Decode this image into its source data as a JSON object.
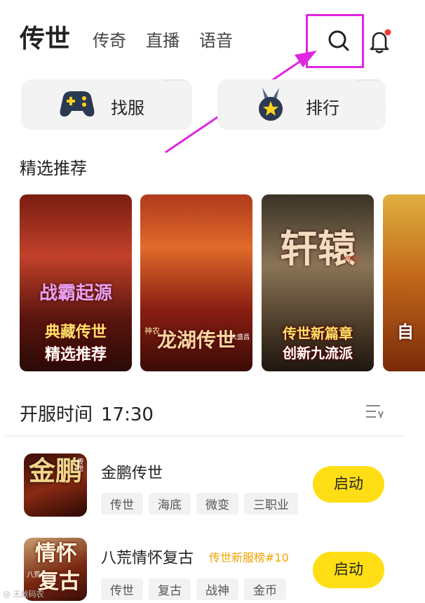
{
  "tabs": {
    "active": "传世",
    "items": [
      "传奇",
      "直播",
      "语音"
    ]
  },
  "quick_actions": {
    "find_server": "找服",
    "ranking": "排行"
  },
  "featured": {
    "title": "精选推荐",
    "posters": [
      {
        "title": "战霸起源",
        "line1": "典藏传世",
        "line2": "精选推荐"
      },
      {
        "title": "龙湖传世",
        "sub": "神农",
        "corner": "大盛昌"
      },
      {
        "title": "轩辕",
        "seal": "传世",
        "line1": "传世新篇章",
        "line2": "创新九流派"
      },
      {
        "title": "自"
      }
    ]
  },
  "open_section": {
    "label": "开服时间",
    "time": "17:30"
  },
  "games": [
    {
      "name": "金鹏传世",
      "icon_text": "金鹏",
      "icon_seal": "传世",
      "tags": [
        "传世",
        "海底",
        "微变",
        "三职业"
      ],
      "button": "启动"
    },
    {
      "name": "八荒情怀复古",
      "badge": "传世新服榜#10",
      "icon_text": "情怀",
      "icon_sub": "八荒",
      "icon_text2": "复古",
      "tags": [
        "传世",
        "复古",
        "战神",
        "金币"
      ],
      "button": "启动"
    }
  ],
  "watermark": "@ 无敌码农",
  "colors": {
    "accent_yellow": "#ffde15",
    "highlight_magenta": "#e026e0",
    "badge_orange": "#f2a300",
    "notification_red": "#f03a3a"
  }
}
